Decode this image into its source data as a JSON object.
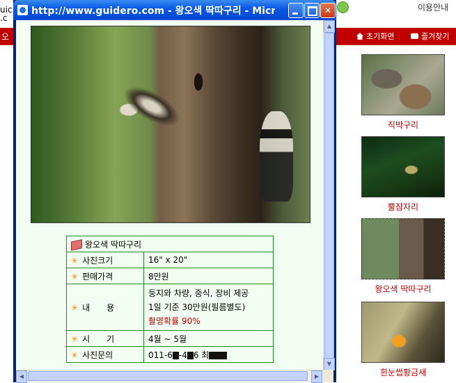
{
  "background_page": {
    "site_text_fragment": "uic\n.c",
    "redbar_fragment": "오",
    "user_menu": "이용안내",
    "nav": {
      "home_label": "초기화면",
      "favorites_label": "즐겨찾기"
    },
    "thumbnails": [
      {
        "caption": "직박구리"
      },
      {
        "caption": "뿔잠자리"
      },
      {
        "caption": "왕오색 딱따구리"
      },
      {
        "caption": "흰눈썹황금새"
      }
    ]
  },
  "popup": {
    "title": "http://www.guidero.com - 왕오색 딱따구리 - Micr...",
    "info": {
      "name": "왕오색 딱따구리",
      "rows": [
        {
          "label": "사진크기",
          "value": "16\" x 20\""
        },
        {
          "label": "판매가격",
          "value": "8만원"
        },
        {
          "label": "내　　용",
          "value_line1": "둥지와 차량, 중식, 장비 제공",
          "value_line2": "1일 기준 30만원(필름별도)",
          "value_line3": "촬영확률 90%"
        },
        {
          "label": "시　　기",
          "value": "4월 ~ 5월"
        },
        {
          "label": "사진문의",
          "value_parts": [
            "011-6",
            "-4",
            "6 최"
          ]
        }
      ]
    }
  },
  "colors": {
    "accent_red": "#c00000",
    "table_border": "#1f8a1f",
    "star": "#ff8800"
  }
}
